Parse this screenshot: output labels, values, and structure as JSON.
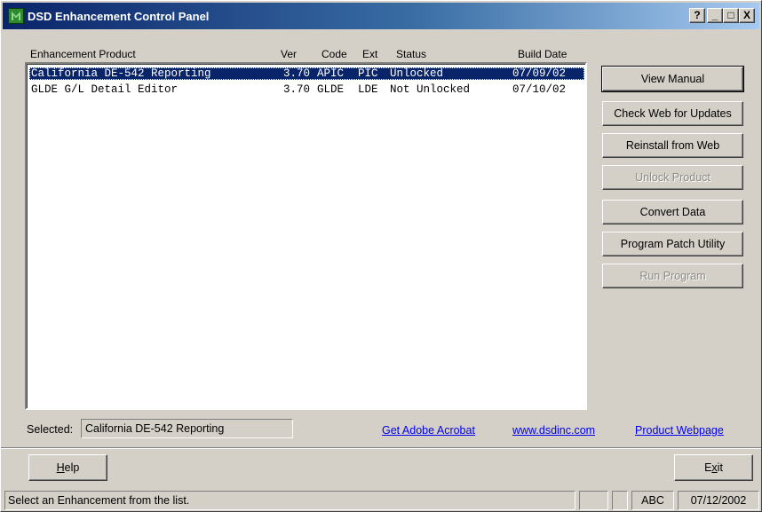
{
  "window": {
    "title": "DSD Enhancement Control Panel",
    "buttons": {
      "help": "?",
      "minimize": "_",
      "maximize": "□",
      "close": "X"
    }
  },
  "list": {
    "headers": {
      "product": "Enhancement Product",
      "ver": "Ver",
      "code": "Code",
      "ext": "Ext",
      "status": "Status",
      "build_date": "Build Date"
    },
    "rows": [
      {
        "product": "California DE-542 Reporting",
        "ver": "3.70",
        "code": "APIC",
        "ext": "PIC",
        "status": "Unlocked",
        "build_date": "07/09/02"
      },
      {
        "product": "GLDE G/L Detail Editor",
        "ver": "3.70",
        "code": "GLDE",
        "ext": "LDE",
        "status": "Not Unlocked",
        "build_date": "07/10/02"
      }
    ]
  },
  "actions": {
    "view_manual": "View Manual",
    "check_web": "Check Web for Updates",
    "reinstall": "Reinstall from Web",
    "unlock": "Unlock Product",
    "convert": "Convert Data",
    "patch": "Program Patch Utility",
    "run": "Run Program"
  },
  "selected": {
    "label": "Selected:",
    "value": "California DE-542 Reporting"
  },
  "links": {
    "acrobat": "Get Adobe Acrobat",
    "website": "www.dsdinc.com",
    "product_page": "Product Webpage"
  },
  "footer": {
    "help_hotkey": "H",
    "help_rest": "elp",
    "exit_pre": "E",
    "exit_hotkey": "x",
    "exit_post": "it"
  },
  "statusbar": {
    "message": "Select an Enhancement from the list.",
    "panel1": "",
    "panel2": "",
    "abc": "ABC",
    "date": "07/12/2002"
  },
  "colors": {
    "selection": "#0a246a",
    "link": "#0000ee",
    "face": "#d4d0c8"
  }
}
